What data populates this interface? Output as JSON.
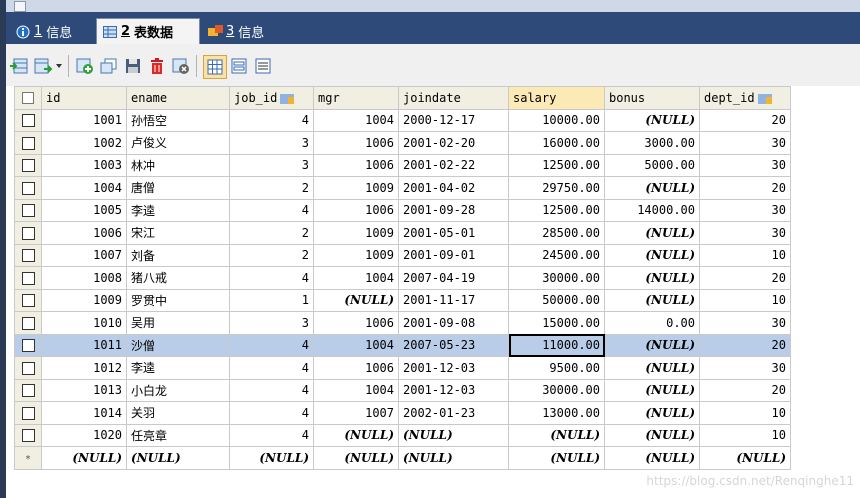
{
  "tabs": [
    {
      "num": "1",
      "label": "信息"
    },
    {
      "num": "2",
      "label": "表数据"
    },
    {
      "num": "3",
      "label": "信息"
    }
  ],
  "columns": [
    "id",
    "ename",
    "job_id",
    "mgr",
    "joindate",
    "salary",
    "bonus",
    "dept_id"
  ],
  "rows": [
    [
      "1001",
      "孙悟空",
      "4",
      "1004",
      "2000-12-17",
      "10000.00",
      "(NULL)",
      "20"
    ],
    [
      "1002",
      "卢俊义",
      "3",
      "1006",
      "2001-02-20",
      "16000.00",
      "3000.00",
      "30"
    ],
    [
      "1003",
      "林冲",
      "3",
      "1006",
      "2001-02-22",
      "12500.00",
      "5000.00",
      "30"
    ],
    [
      "1004",
      "唐僧",
      "2",
      "1009",
      "2001-04-02",
      "29750.00",
      "(NULL)",
      "20"
    ],
    [
      "1005",
      "李逵",
      "4",
      "1006",
      "2001-09-28",
      "12500.00",
      "14000.00",
      "30"
    ],
    [
      "1006",
      "宋江",
      "2",
      "1009",
      "2001-05-01",
      "28500.00",
      "(NULL)",
      "30"
    ],
    [
      "1007",
      "刘备",
      "2",
      "1009",
      "2001-09-01",
      "24500.00",
      "(NULL)",
      "10"
    ],
    [
      "1008",
      "猪八戒",
      "4",
      "1004",
      "2007-04-19",
      "30000.00",
      "(NULL)",
      "20"
    ],
    [
      "1009",
      "罗贯中",
      "1",
      "(NULL)",
      "2001-11-17",
      "50000.00",
      "(NULL)",
      "10"
    ],
    [
      "1010",
      "吴用",
      "3",
      "1006",
      "2001-09-08",
      "15000.00",
      "0.00",
      "30"
    ],
    [
      "1011",
      "沙僧",
      "4",
      "1004",
      "2007-05-23",
      "11000.00",
      "(NULL)",
      "20"
    ],
    [
      "1012",
      "李逵",
      "4",
      "1006",
      "2001-12-03",
      "9500.00",
      "(NULL)",
      "30"
    ],
    [
      "1013",
      "小白龙",
      "4",
      "1004",
      "2001-12-03",
      "30000.00",
      "(NULL)",
      "20"
    ],
    [
      "1014",
      "关羽",
      "4",
      "1007",
      "2002-01-23",
      "13000.00",
      "(NULL)",
      "10"
    ],
    [
      "1020",
      "任亮章",
      "4",
      "(NULL)",
      "(NULL)",
      "(NULL)",
      "(NULL)",
      "10"
    ]
  ],
  "new_row": [
    "(NULL)",
    "(NULL)",
    "(NULL)",
    "(NULL)",
    "(NULL)",
    "(NULL)",
    "(NULL)",
    "(NULL)"
  ],
  "new_row_marker": "*",
  "selected_row_index": 10,
  "focused_column": "salary",
  "watermark": "https://blog.csdn.net/Renqinghe11"
}
